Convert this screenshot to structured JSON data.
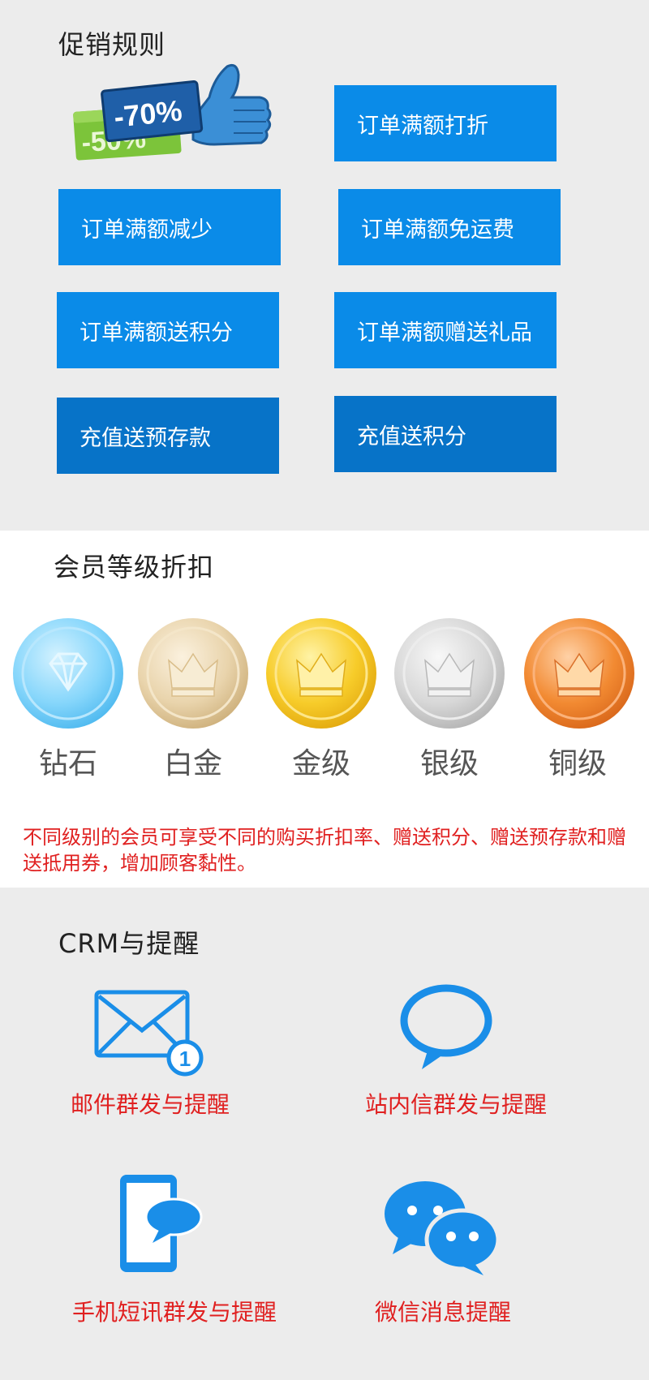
{
  "promo": {
    "title": "促销规则",
    "graphic": {
      "tag_front": "-70%",
      "tag_back": "-50%"
    },
    "buttons": [
      "订单满额打折",
      "订单满额减少",
      "订单满额免运费",
      "订单满额送积分",
      "订单满额赠送礼品",
      "充值送预存款",
      "充值送积分"
    ]
  },
  "member": {
    "title": "会员等级折扣",
    "levels": [
      {
        "label": "钻石",
        "icon": "diamond-icon",
        "color": "#7fd3fb"
      },
      {
        "label": "白金",
        "icon": "crown-icon",
        "color": "#e8d3ab"
      },
      {
        "label": "金级",
        "icon": "crown-icon",
        "color": "#f6c627"
      },
      {
        "label": "银级",
        "icon": "crown-icon",
        "color": "#d9d9d9"
      },
      {
        "label": "铜级",
        "icon": "crown-icon",
        "color": "#f28a32"
      }
    ],
    "note": "不同级别的会员可享受不同的购买折扣率、赠送积分、赠送预存款和赠送抵用券，增加顾客黏性。"
  },
  "crm": {
    "title": "CRM与提醒",
    "items": [
      {
        "label": "邮件群发与提醒",
        "icon": "mail-icon",
        "badge": "1"
      },
      {
        "label": "站内信群发与提醒",
        "icon": "speech-bubble-icon"
      },
      {
        "label": "手机短讯群发与提醒",
        "icon": "mobile-sms-icon"
      },
      {
        "label": "微信消息提醒",
        "icon": "wechat-icon"
      }
    ]
  },
  "colors": {
    "accent": "#0a8be8",
    "accent_dark": "#0773c8",
    "alert": "#e02020"
  }
}
